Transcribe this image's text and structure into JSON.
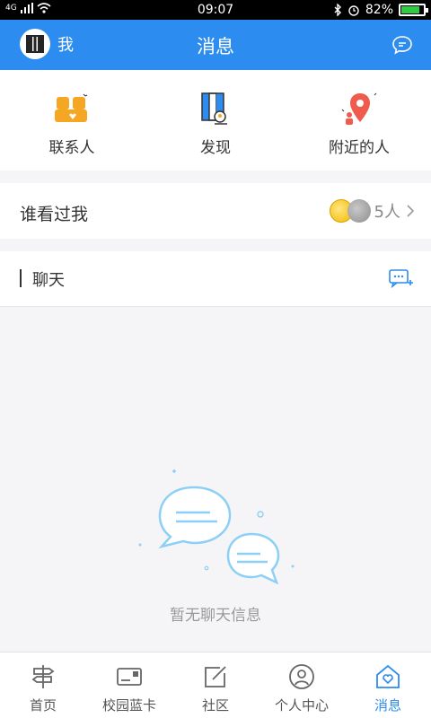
{
  "status": {
    "network": "4G",
    "time": "09:07",
    "battery_text": "82%",
    "battery_level": 0.82
  },
  "app_bar": {
    "me_label": "我",
    "title": "消息"
  },
  "quick_actions": [
    {
      "label": "联系人",
      "icon": "contacts-icon"
    },
    {
      "label": "发现",
      "icon": "discover-map-icon"
    },
    {
      "label": "附近的人",
      "icon": "nearby-pin-icon"
    }
  ],
  "visitors": {
    "label": "谁看过我",
    "count": "5人"
  },
  "chat": {
    "label": "聊天"
  },
  "empty_state": {
    "text": "暂无聊天信息"
  },
  "tabs": [
    {
      "label": "首页",
      "icon": "signpost-icon",
      "active": false
    },
    {
      "label": "校园蓝卡",
      "icon": "card-icon",
      "active": false
    },
    {
      "label": "社区",
      "icon": "edit-icon",
      "active": false
    },
    {
      "label": "个人中心",
      "icon": "person-icon",
      "active": false
    },
    {
      "label": "消息",
      "icon": "message-home-icon",
      "active": true
    }
  ],
  "colors": {
    "primary": "#2d8cf0",
    "accent_orange": "#f5a623",
    "accent_red": "#ef5b4c"
  }
}
